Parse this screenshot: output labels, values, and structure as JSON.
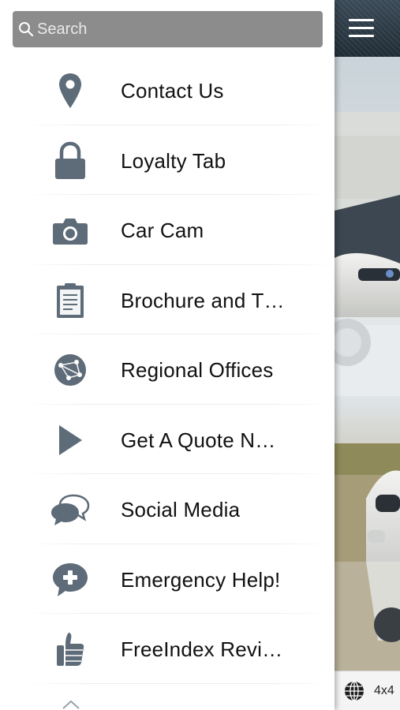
{
  "search": {
    "placeholder": "Search"
  },
  "menu": {
    "items": [
      {
        "label": "Contact Us",
        "icon": "location-pin-icon"
      },
      {
        "label": "Loyalty Tab",
        "icon": "lock-icon"
      },
      {
        "label": "Car Cam",
        "icon": "camera-icon"
      },
      {
        "label": "Brochure and T…",
        "icon": "clipboard-icon"
      },
      {
        "label": "Regional Offices",
        "icon": "globe-network-icon"
      },
      {
        "label": "Get A Quote N…",
        "icon": "play-icon"
      },
      {
        "label": "Social Media",
        "icon": "chat-bubbles-icon"
      },
      {
        "label": "Emergency Help!",
        "icon": "chat-plus-icon"
      },
      {
        "label": "FreeIndex Revi…",
        "icon": "thumbs-up-icon"
      }
    ]
  },
  "content": {
    "bottom_bar_label": "4x4"
  },
  "colors": {
    "icon_gray": "#5e6b78",
    "search_bg": "#8c8c8c",
    "topbar": "#2c3a45"
  }
}
